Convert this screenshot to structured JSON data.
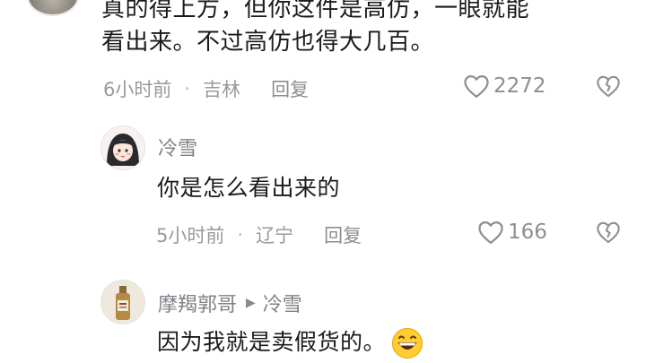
{
  "comment1": {
    "line1": "真的得上方，但你这件是高仿，一眼就能",
    "line2": "看出来。不过高仿也得大几百。",
    "time": "6小时前",
    "location": "吉林",
    "reply_label": "回复",
    "likes": "2272"
  },
  "reply1": {
    "username": "冷雪",
    "text": "你是怎么看出来的",
    "time": "5小时前",
    "location": "辽宁",
    "reply_label": "回复",
    "likes": "166"
  },
  "reply2": {
    "username": "摩羯郭哥",
    "reply_to": "冷雪",
    "text": "因为我就是卖假货的。"
  },
  "meta_separator": "·",
  "icons": {
    "like": "heart-outline-icon",
    "dislike": "broken-heart-icon",
    "reply_arrow": "play-arrow-icon",
    "emoji": "grinning-face-icon"
  },
  "colors": {
    "text": "#1b1b1b",
    "meta": "#9a9a9a",
    "username": "#7f8187"
  }
}
